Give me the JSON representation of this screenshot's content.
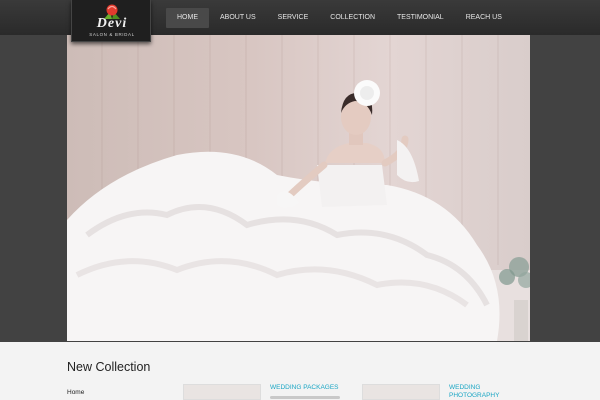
{
  "brand": {
    "name": "Devi",
    "tagline": "SALON & BRIDAL"
  },
  "nav": {
    "items": [
      "HOME",
      "ABOUT US",
      "SERVICE",
      "COLLECTION",
      "TESTIMONIAL",
      "REACH US"
    ],
    "active_index": 0
  },
  "hero": {
    "image_description": "bride in white ruffled gown"
  },
  "section": {
    "title": "New Collection",
    "sidebar_link": "Home",
    "cards": [
      {
        "title": "WEDDING PACKAGES"
      },
      {
        "title": "WEDDING PHOTOGRAPHY"
      }
    ]
  },
  "colors": {
    "header": "#2f2f2f",
    "band": "#424242",
    "accent": "#1aa6c4",
    "page": "#f3f3f3"
  }
}
